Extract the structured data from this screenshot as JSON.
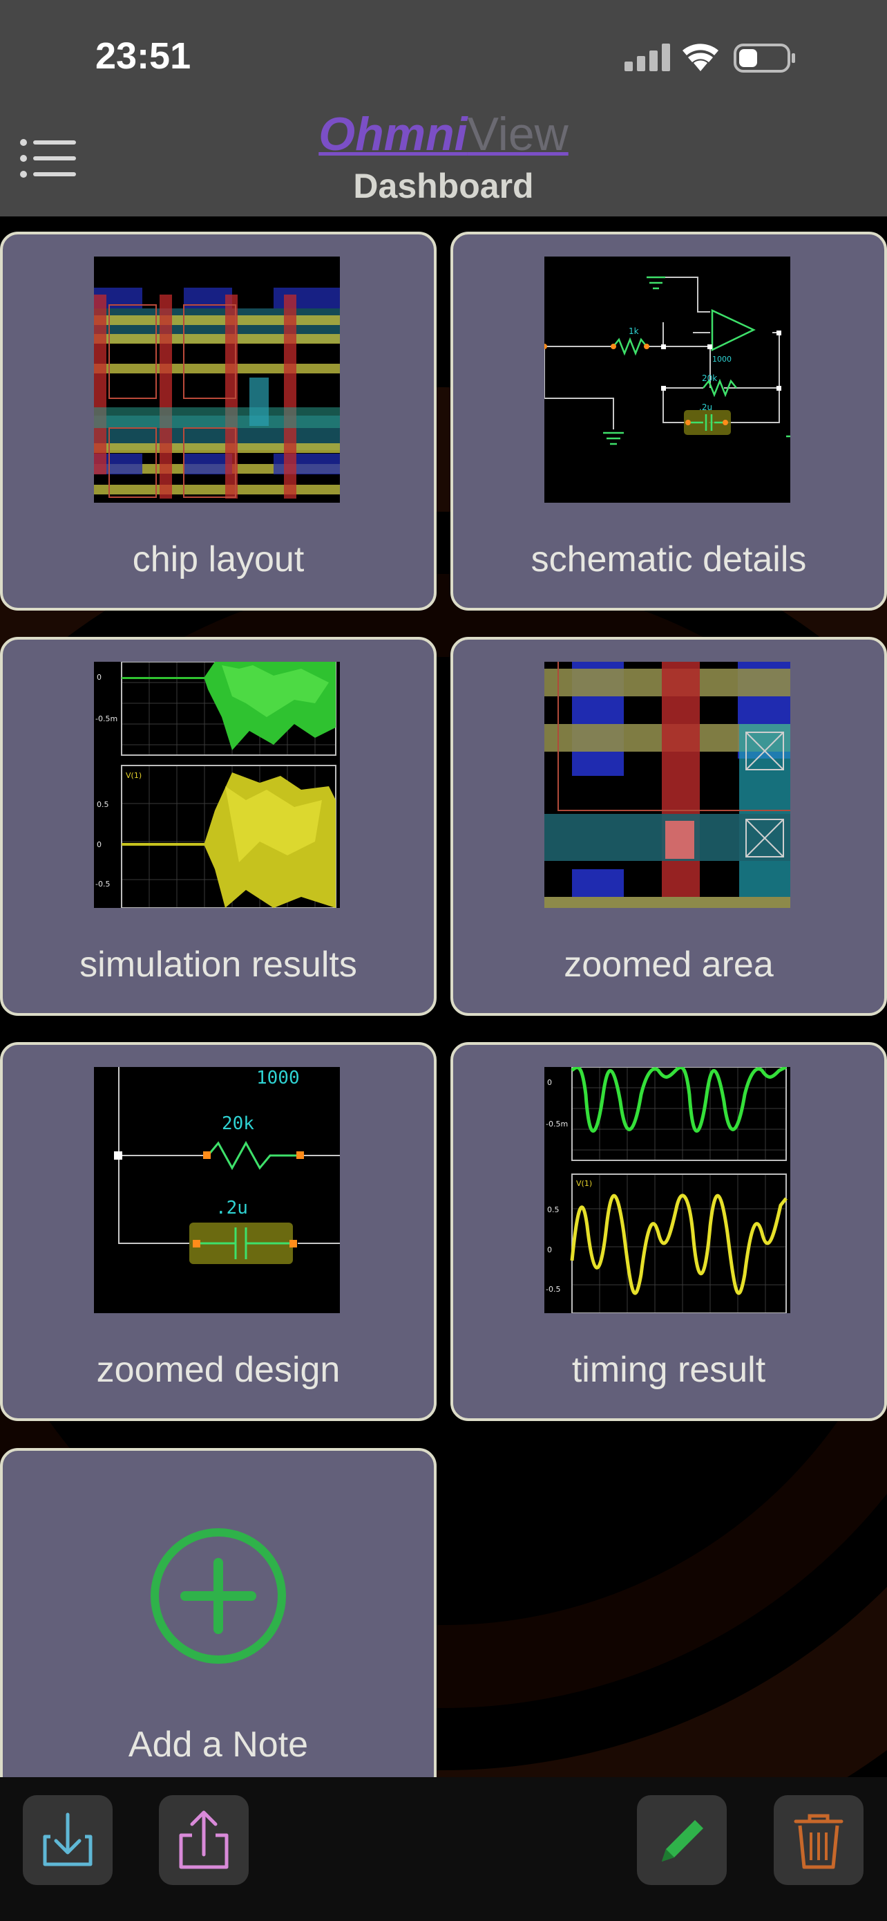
{
  "status": {
    "time": "23:51"
  },
  "header": {
    "brand_part1": "Ohmni",
    "brand_part2": "View",
    "title": "Dashboard"
  },
  "cards": [
    {
      "label": "chip layout"
    },
    {
      "label": "schematic details"
    },
    {
      "label": "simulation results"
    },
    {
      "label": "zoomed area"
    },
    {
      "label": "zoomed design"
    },
    {
      "label": "timing result"
    }
  ],
  "add_note": {
    "label": "Add a Note"
  },
  "thumbs": {
    "schematic": {
      "r1": "1k",
      "r2": "20k",
      "c1": ".2u",
      "gain": "1000"
    },
    "sim": {
      "y0": "0",
      "yneg": "-0.5m",
      "trace": "V(1)",
      "y05": "0.5",
      "y0b": "0",
      "yneg2": "-0.5"
    },
    "design": {
      "gain": "1000",
      "r": "20k",
      "c": ".2u"
    },
    "timing": {
      "y0": "0",
      "yneg": "-0.5m",
      "trace": "V(1)",
      "y05": "0.5",
      "y0b": "0",
      "yneg2": "-0.5"
    }
  },
  "toolbar": {
    "import": "import-icon",
    "share": "share-icon",
    "edit": "pencil-icon",
    "delete": "trash-icon"
  }
}
